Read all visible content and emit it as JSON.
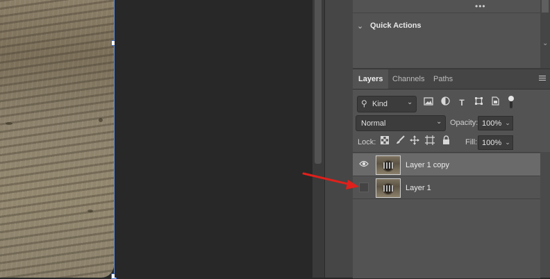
{
  "quick_actions": {
    "more_glyph": "•••",
    "title": "Quick Actions"
  },
  "layers_panel": {
    "tabs": [
      {
        "label": "Layers",
        "active": true
      },
      {
        "label": "Channels",
        "active": false
      },
      {
        "label": "Paths",
        "active": false
      }
    ],
    "filter": {
      "kind_label": "Kind",
      "filter_icons": [
        "image-filter-icon",
        "adjustment-filter-icon",
        "type-filter-icon",
        "shape-filter-icon",
        "smart-object-filter-icon"
      ]
    },
    "blend_mode": "Normal",
    "opacity_label": "Opacity:",
    "opacity_value": "100%",
    "lock_label": "Lock:",
    "lock_icons": [
      "lock-transparent-pixels-icon",
      "lock-image-pixels-icon",
      "lock-position-icon",
      "lock-artboard-icon",
      "lock-all-icon"
    ],
    "fill_label": "Fill:",
    "fill_value": "100%",
    "layers": [
      {
        "name": "Layer 1 copy",
        "visible": true,
        "selected": true
      },
      {
        "name": "Layer 1",
        "visible": false,
        "selected": false
      }
    ]
  },
  "annotation": {
    "color": "#e0201b"
  },
  "colors": {
    "panel_bg": "#535353",
    "selected_row": "#6a6a6a",
    "pasteboard": "#282828",
    "transform_outline": "#6a8fd0"
  }
}
